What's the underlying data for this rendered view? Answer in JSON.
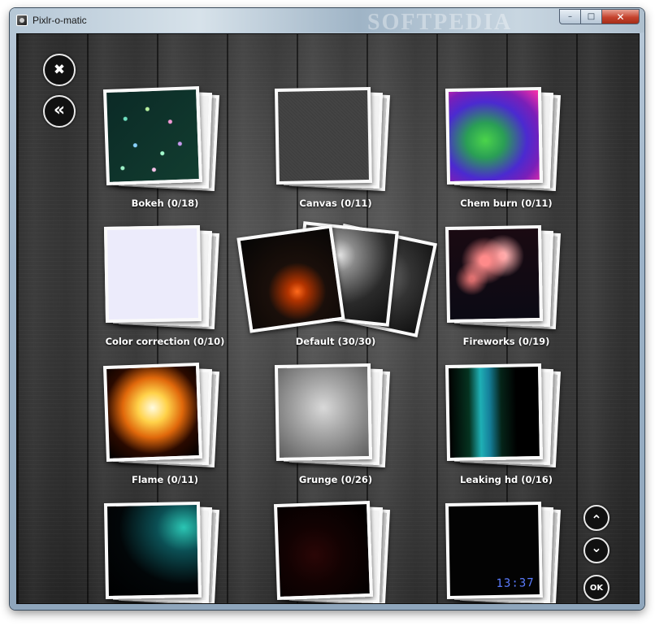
{
  "window": {
    "title": "Pixlr-o-matic",
    "watermark": "SOFTPEDIA",
    "minimize_glyph": "–",
    "maximize_glyph": "□",
    "close_glyph": "✕"
  },
  "nav": {
    "close_glyph": "✖",
    "back_glyph": "«",
    "scroll_up_glyph": "⌃",
    "scroll_down_glyph": "⌄",
    "ok_label": "OK"
  },
  "categories": [
    {
      "label": "Bokeh (0/18)",
      "thumb": "bokeh"
    },
    {
      "label": "Canvas (0/11)",
      "thumb": "canvas"
    },
    {
      "label": "Chem burn (0/11)",
      "thumb": "chem"
    },
    {
      "label": "Color correction (0/10)",
      "thumb": "color"
    },
    {
      "label": "Default (30/30)",
      "thumb": "default"
    },
    {
      "label": "Fireworks (0/19)",
      "thumb": "fireworks"
    },
    {
      "label": "Flame (0/11)",
      "thumb": "flame"
    },
    {
      "label": "Grunge (0/26)",
      "thumb": "grunge"
    },
    {
      "label": "Leaking hd (0/16)",
      "thumb": "leak"
    },
    {
      "label": "",
      "thumb": "teal-light"
    },
    {
      "label": "",
      "thumb": "red-swirl"
    },
    {
      "label": "",
      "thumb": "dark-clock",
      "overlay_text": "13:37"
    }
  ],
  "colors": {
    "accent_close": "#c5422d",
    "label_text": "#ffffff"
  }
}
